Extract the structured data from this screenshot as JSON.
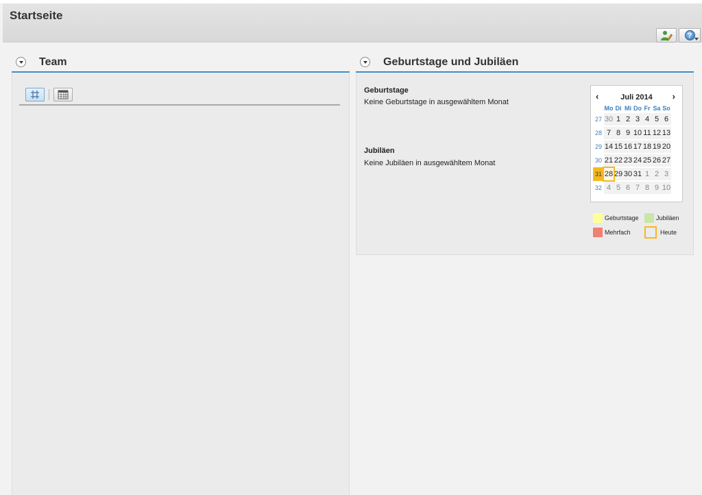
{
  "page": {
    "title": "Startseite"
  },
  "header": {
    "help_symbol": "?",
    "icons": [
      "person-edit-icon",
      "help-icon"
    ]
  },
  "team": {
    "title": "Team",
    "icons": [
      "collapse-toggle-icon",
      "grid-view-icon",
      "table-view-icon"
    ]
  },
  "birthdays": {
    "title": "Geburtstage und Jubiläen",
    "birthday_label": "Geburtstage",
    "birthday_text": "Keine Geburtstage in ausgewähltem Monat",
    "anniversary_label": "Jubiläen",
    "anniversary_text": "Keine Jubiläen in ausgewähltem Monat"
  },
  "calendar": {
    "prev": "‹",
    "next": "›",
    "month": "Juli 2014",
    "weekdays": [
      "Mo",
      "Di",
      "Mi",
      "Do",
      "Fr",
      "Sa",
      "So"
    ],
    "weeks": [
      {
        "wk": "27",
        "days": [
          "30",
          "1",
          "2",
          "3",
          "4",
          "5",
          "6"
        ]
      },
      {
        "wk": "28",
        "days": [
          "7",
          "8",
          "9",
          "10",
          "11",
          "12",
          "13"
        ]
      },
      {
        "wk": "29",
        "days": [
          "14",
          "15",
          "16",
          "17",
          "18",
          "19",
          "20"
        ]
      },
      {
        "wk": "30",
        "days": [
          "21",
          "22",
          "23",
          "24",
          "25",
          "26",
          "27"
        ]
      },
      {
        "wk": "31",
        "days": [
          "28",
          "29",
          "30",
          "31",
          "1",
          "2",
          "3"
        ]
      },
      {
        "wk": "32",
        "days": [
          "4",
          "5",
          "6",
          "7",
          "8",
          "9",
          "10"
        ]
      }
    ],
    "today": "28"
  },
  "legend": {
    "birthdays": "Geburtstage",
    "anniversaries": "Jubiläen",
    "multiple": "Mehrfach",
    "today": "Heute",
    "colors": {
      "birthdays": "#ffff99",
      "anniversaries": "#c8e6a8",
      "multiple": "#f08070",
      "today": "#f5b920"
    }
  }
}
